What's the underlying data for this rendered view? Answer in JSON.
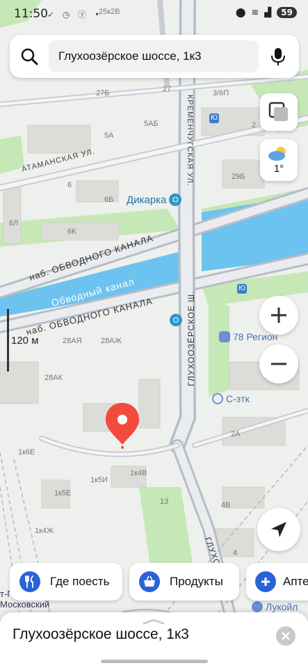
{
  "status_bar": {
    "time": "11:50",
    "battery": "59"
  },
  "search": {
    "query": "Глухоозёрское шоссе, 1к3"
  },
  "weather": {
    "temp": "1°"
  },
  "map": {
    "scale": "120 м",
    "labels": {
      "street_atamanskaya": "АТАМАНСКАЯ УЛ.",
      "street_kremenchugskaya": "КРЕМЕНЧУГСКАЯ УЛ.",
      "street_obvodnogo_1": "наб. ОБВОДНОГО КАНАЛА",
      "street_obvodnogo_2": "наб. ОБВОДНОГО КАНАЛА",
      "canal": "Обводный канал",
      "street_glukhoozerskoe_1": "ГЛУХООЗЁРСКОЕ Ш.",
      "street_glukhoozerskoe_2": "ГЛУХОО",
      "poi_dikarka": "Дикарка",
      "poi_78region": "78 Регион",
      "poi_sztk": "С-зтк",
      "poi_lukoil": "Лукойл",
      "station_1": "т-Петербург",
      "station_2": "Московский"
    },
    "buildings": [
      "25к2В",
      "27",
      "27Б",
      "3/6П",
      "5А",
      "5АБ",
      "2",
      "29Б",
      "6",
      "6Б",
      "6Л",
      "6К",
      "28АЯ",
      "28АЖ",
      "28АК",
      "2А",
      "1к6Е",
      "1к4В",
      "1к5И",
      "1к5Е",
      "1к4Ж",
      "13",
      "4В",
      "4"
    ]
  },
  "categories": [
    {
      "label": "Где поесть",
      "icon": "fork-knife-icon"
    },
    {
      "label": "Продукты",
      "icon": "basket-icon"
    },
    {
      "label": "Апте",
      "icon": "plus-icon"
    }
  ],
  "bottom_sheet": {
    "title": "Глухоозёрское шоссе, 1к3"
  },
  "colors": {
    "water": "#6cc3ef",
    "road": "#b7bdc6",
    "greenery": "#c6e7b6",
    "marker": "#f24b3d",
    "accent": "#2b62d8"
  }
}
